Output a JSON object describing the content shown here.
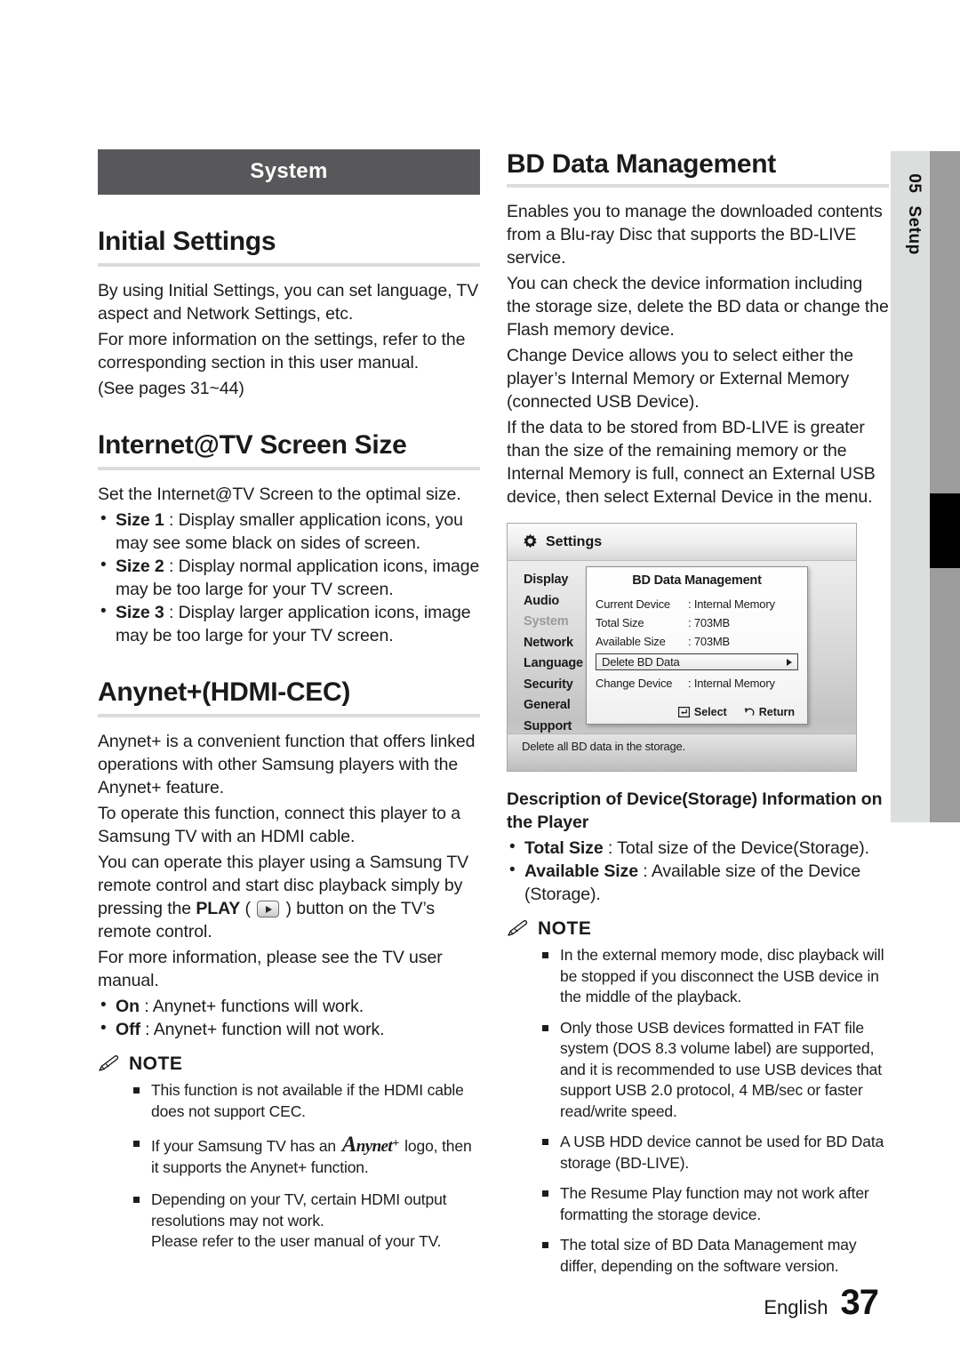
{
  "page": {
    "chapter_number": "05",
    "chapter_label": "Setup",
    "language": "English",
    "page_number": "37"
  },
  "left": {
    "banner": "System",
    "initial_settings": {
      "heading": "Initial Settings",
      "paragraphs": [
        "By using Initial Settings, you can set language, TV aspect and Network Settings, etc.",
        "For more information on the settings, refer to the corresponding section in this user manual.",
        "(See pages 31~44)"
      ]
    },
    "internet_tv": {
      "heading": "Internet@TV Screen Size",
      "intro": "Set the Internet@TV Screen to the optimal size.",
      "items": [
        {
          "term": "Size 1",
          "desc": " : Display smaller application icons, you may see some black on sides of screen."
        },
        {
          "term": "Size 2",
          "desc": " : Display normal application icons, image may be too large for your TV screen."
        },
        {
          "term": "Size 3",
          "desc": " : Display larger application icons, image may be too large for your TV screen."
        }
      ]
    },
    "anynet": {
      "heading": "Anynet+(HDMI-CEC)",
      "para1": "Anynet+ is a convenient function that offers linked operations with other Samsung players with the Anynet+ feature.",
      "para2": "To operate this function, connect this player to a Samsung TV with an HDMI cable.",
      "para3_before": "You can operate this player using a Samsung TV remote control and start disc playback simply by pressing the ",
      "para3_bold": "PLAY",
      "para3_mid": " ( ",
      "para3_after": " ) button on the TV’s remote control.",
      "para4": "For more information, please see the TV user manual.",
      "items": [
        {
          "term": "On",
          "desc": " : Anynet+ functions will work."
        },
        {
          "term": "Off",
          "desc": " : Anynet+ function will not work."
        }
      ],
      "note_label": "NOTE",
      "notes": [
        {
          "text": "This function is not available if the HDMI cable does not support CEC."
        },
        {
          "before": "If your Samsung TV has an ",
          "logo": "Anynet+",
          "after": " logo, then it supports the Anynet+ function."
        },
        {
          "text": "Depending on your TV, certain HDMI output resolutions may not work.\nPlease refer to the user manual of your TV."
        }
      ]
    }
  },
  "right": {
    "bd_data": {
      "heading": "BD Data Management",
      "paragraphs": [
        "Enables you to manage the downloaded contents from a Blu-ray Disc that supports the BD-LIVE service.",
        "You can check the device information including the storage size, delete the BD data or change the Flash memory device.",
        "Change Device allows you to select either the player’s Internal Memory or External Memory (connected USB Device).",
        "If the data to be stored from BD-LIVE is greater than the size of the remaining memory or the Internal Memory is full, connect an External USB device, then select External Device in the menu."
      ]
    },
    "tv_screen": {
      "title": "Settings",
      "menu": [
        {
          "label": "Display",
          "state": "normal"
        },
        {
          "label": "Audio",
          "state": "normal"
        },
        {
          "label": "System",
          "state": "dimmed"
        },
        {
          "label": "Network",
          "state": "normal"
        },
        {
          "label": "Language",
          "state": "normal"
        },
        {
          "label": "Security",
          "state": "normal"
        },
        {
          "label": "General",
          "state": "normal"
        },
        {
          "label": "Support",
          "state": "normal"
        }
      ],
      "dialog_title": "BD Data Management",
      "rows": [
        {
          "key": "Current Device",
          "value": ": Internal Memory"
        },
        {
          "key": "Total Size",
          "value": ": 703MB"
        },
        {
          "key": "Available Size",
          "value": ": 703MB"
        }
      ],
      "highlight_row": "Delete BD Data",
      "change_device": {
        "key": "Change Device",
        "value": ": Internal Memory"
      },
      "footer_select": "Select",
      "footer_return": "Return",
      "status_text": "Delete all BD data in the storage."
    },
    "description": {
      "heading": "Description of Device(Storage) Information on the Player",
      "items": [
        {
          "term": "Total Size",
          "desc": " : Total size of the Device(Storage)."
        },
        {
          "term": "Available Size",
          "desc": " : Available size of the Device (Storage)."
        }
      ]
    },
    "note_label": "NOTE",
    "notes": [
      "In the external memory mode, disc playback will be stopped if you disconnect the USB device in the middle of the playback.",
      "Only those USB devices formatted in FAT file system (DOS 8.3 volume label) are supported, and it is recommended to use USB devices that support USB 2.0 protocol, 4 MB/sec or faster read/write speed.",
      "A USB HDD device cannot be used for BD Data storage (BD-LIVE).",
      "The Resume Play function may not work after formatting the storage device.",
      "The total size of BD Data Management may differ, depending on the software version."
    ]
  }
}
